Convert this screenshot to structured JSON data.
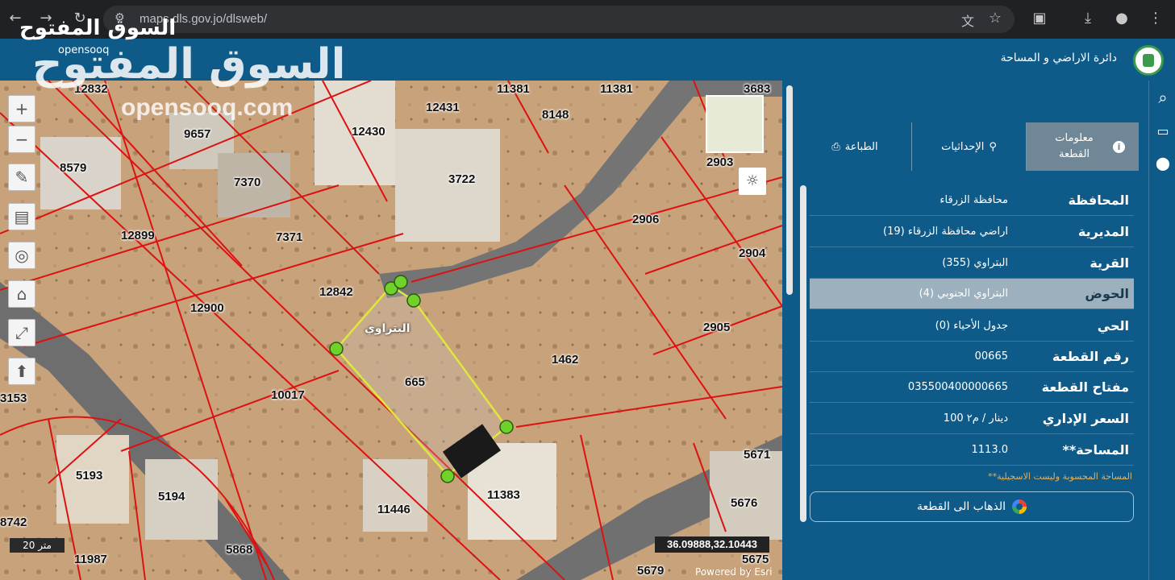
{
  "browser": {
    "url": "maps.dls.gov.jo/dlsweb/"
  },
  "app": {
    "department_title": "دائرة الاراضي و المساحة",
    "watermark_ar": "السوق المفتوح",
    "watermark_en": "opensooq",
    "watermark_en_big": "opensooq.com",
    "watermark_big": "السوق المفتوح"
  },
  "map": {
    "parcels": [
      {
        "id": "12832"
      },
      {
        "id": "11381"
      },
      {
        "id": "11381b",
        "label": "11381"
      },
      {
        "id": "3683"
      },
      {
        "id": "12431"
      },
      {
        "id": "8148"
      },
      {
        "id": "9657"
      },
      {
        "id": "12430"
      },
      {
        "id": "8579"
      },
      {
        "id": "7370"
      },
      {
        "id": "3722"
      },
      {
        "id": "2903"
      },
      {
        "id": "12899"
      },
      {
        "id": "7371"
      },
      {
        "id": "2906"
      },
      {
        "id": "2904"
      },
      {
        "id": "12842"
      },
      {
        "id": "12900"
      },
      {
        "id": "2905"
      },
      {
        "id": "1462"
      },
      {
        "id": "665"
      },
      {
        "id": "10017"
      },
      {
        "id": "3153"
      },
      {
        "id": "5193"
      },
      {
        "id": "5194"
      },
      {
        "id": "11383"
      },
      {
        "id": "11446"
      },
      {
        "id": "5671"
      },
      {
        "id": "5676"
      },
      {
        "id": "8742"
      },
      {
        "id": "11987"
      },
      {
        "id": "5868"
      },
      {
        "id": "5675"
      },
      {
        "id": "5679"
      }
    ],
    "plot_name": "البتراوي",
    "scale": "20 متر",
    "coordinates": "36.09888,32.10443",
    "powered_by": "Powered by Esri"
  },
  "panel": {
    "tabs": [
      {
        "label": "معلومات القطعة",
        "icon": "info-icon",
        "active": true
      },
      {
        "label": "الإحداثيات",
        "icon": "location-user-icon",
        "active": false
      },
      {
        "label": "الطباعة",
        "icon": "printer-icon",
        "active": false
      }
    ],
    "rows": [
      {
        "label": "المحافظة",
        "value": "محافظة الزرقاء"
      },
      {
        "label": "المديرية",
        "value": "اراضي محافظة الزرقاء (19)"
      },
      {
        "label": "القرية",
        "value": "البتراوي (355)"
      },
      {
        "label": "الحوض",
        "value": "البتراوي الجنوبي (4)",
        "selected": true
      },
      {
        "label": "الحي",
        "value": "جدول الأحياء (0)"
      },
      {
        "label": "رقم القطعة",
        "value": "00665"
      },
      {
        "label": "مفتاح القطعة",
        "value": "035500400000665"
      },
      {
        "label": "السعر الإداري",
        "value": "100 دينار / م٢"
      },
      {
        "label": "**المساحة",
        "value": "1113.0"
      }
    ],
    "note": "**المساحة المحسوبة وليست الاسجيلية",
    "goto_button": "الذهاب الى القطعة"
  }
}
